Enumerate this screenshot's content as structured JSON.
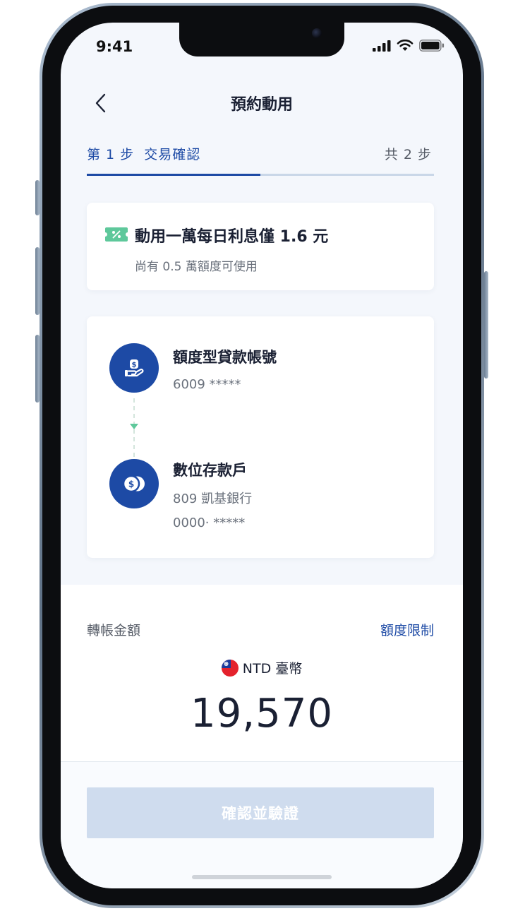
{
  "status_bar": {
    "time": "9:41"
  },
  "header": {
    "title": "預約動用"
  },
  "steps": {
    "current_label": "第 1 步  交易確認",
    "total_label": "共 2 步",
    "progress_fraction": 0.5
  },
  "promo": {
    "title": "動用一萬每日利息僅 1.6 元",
    "subtitle": "尚有 0.5 萬額度可使用"
  },
  "from_account": {
    "name": "額度型貸款帳號",
    "number": "6009 *****"
  },
  "to_account": {
    "name": "數位存款戶",
    "bank": "809 凱基銀行",
    "number": "0000· *****"
  },
  "amount": {
    "label": "轉帳金額",
    "limit_link": "額度限制",
    "currency": "NTD 臺幣",
    "value": "19,570"
  },
  "actions": {
    "confirm_label": "確認並驗證"
  },
  "colors": {
    "primary": "#1d4aa5",
    "accent_green": "#5ec89b",
    "disabled_button": "#cfdcee"
  }
}
